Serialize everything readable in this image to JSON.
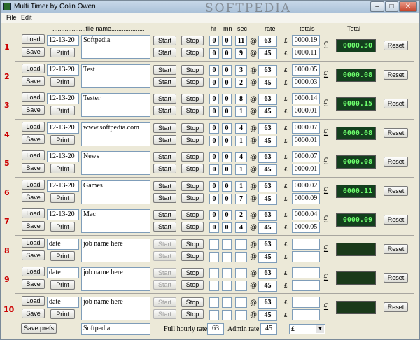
{
  "window": {
    "title": "Multi Timer by Colin Owen",
    "watermark": "SOFTPEDIA"
  },
  "menu": [
    "File",
    "Edit"
  ],
  "headers": {
    "file_name": "...................file name...................",
    "hr": "hr",
    "mn": "mn",
    "sec": "sec",
    "rate": "rate",
    "totals": "totals",
    "total": "Total"
  },
  "labels": {
    "load": "Load",
    "save": "Save",
    "print": "Print",
    "start": "Start",
    "stop": "Stop",
    "reset": "Reset",
    "at": "@",
    "pound_small": "£",
    "pound": "£"
  },
  "rows": [
    {
      "num": "1",
      "date": "12-13-20",
      "name": "Softpedia",
      "t1": [
        "0",
        "0",
        "11"
      ],
      "t2": [
        "0",
        "0",
        "9"
      ],
      "r1": "63",
      "r2": "45",
      "tot1": "0000.19",
      "tot2": "0000.11",
      "total": "0000.30",
      "active": true
    },
    {
      "num": "2",
      "date": "12-13-20",
      "name": "Test",
      "t1": [
        "0",
        "0",
        "3"
      ],
      "t2": [
        "0",
        "0",
        "2"
      ],
      "r1": "63",
      "r2": "45",
      "tot1": "0000.05",
      "tot2": "0000.03",
      "total": "0000.08",
      "active": true
    },
    {
      "num": "3",
      "date": "12-13-20",
      "name": "Tester",
      "t1": [
        "0",
        "0",
        "8"
      ],
      "t2": [
        "0",
        "0",
        "1"
      ],
      "r1": "63",
      "r2": "45",
      "tot1": "0000.14",
      "tot2": "0000.01",
      "total": "0000.15",
      "active": true
    },
    {
      "num": "4",
      "date": "12-13-20",
      "name": "www.softpedia.com",
      "t1": [
        "0",
        "0",
        "4"
      ],
      "t2": [
        "0",
        "0",
        "1"
      ],
      "r1": "63",
      "r2": "45",
      "tot1": "0000.07",
      "tot2": "0000.01",
      "total": "0000.08",
      "active": true
    },
    {
      "num": "5",
      "date": "12-13-20",
      "name": "News",
      "t1": [
        "0",
        "0",
        "4"
      ],
      "t2": [
        "0",
        "0",
        "1"
      ],
      "r1": "63",
      "r2": "45",
      "tot1": "0000.07",
      "tot2": "0000.01",
      "total": "0000.08",
      "active": true
    },
    {
      "num": "6",
      "date": "12-13-20",
      "name": "Games",
      "t1": [
        "0",
        "0",
        "1"
      ],
      "t2": [
        "0",
        "0",
        "7"
      ],
      "r1": "63",
      "r2": "45",
      "tot1": "0000.02",
      "tot2": "0000.09",
      "total": "0000.11",
      "active": true
    },
    {
      "num": "7",
      "date": "12-13-20",
      "name": "Mac",
      "t1": [
        "0",
        "0",
        "2"
      ],
      "t2": [
        "0",
        "0",
        "4"
      ],
      "r1": "63",
      "r2": "45",
      "tot1": "0000.04",
      "tot2": "0000.05",
      "total": "0000.09",
      "active": true
    },
    {
      "num": "8",
      "date": "date",
      "name": "job name here",
      "t1": [
        "",
        "",
        ""
      ],
      "t2": [
        "",
        "",
        ""
      ],
      "r1": "63",
      "r2": "45",
      "tot1": "",
      "tot2": "",
      "total": "",
      "active": false
    },
    {
      "num": "9",
      "date": "date",
      "name": "job name here",
      "t1": [
        "",
        "",
        ""
      ],
      "t2": [
        "",
        "",
        ""
      ],
      "r1": "63",
      "r2": "45",
      "tot1": "",
      "tot2": "",
      "total": "",
      "active": false
    },
    {
      "num": "10",
      "date": "date",
      "name": "job name here",
      "t1": [
        "",
        "",
        ""
      ],
      "t2": [
        "",
        "",
        ""
      ],
      "r1": "63",
      "r2": "45",
      "tot1": "",
      "tot2": "",
      "total": "",
      "active": false
    }
  ],
  "footer": {
    "save_prefs": "Save prefs",
    "company": "Softpedia",
    "full_rate_label": "Full hourly rate:",
    "full_rate": "63",
    "admin_rate_label": "Admin rate:",
    "admin_rate": "45",
    "currency": "£"
  },
  "colors": {
    "row_number": "#cc0000",
    "lcd_bg": "#133f1d",
    "lcd_text": "#6dff6d"
  }
}
